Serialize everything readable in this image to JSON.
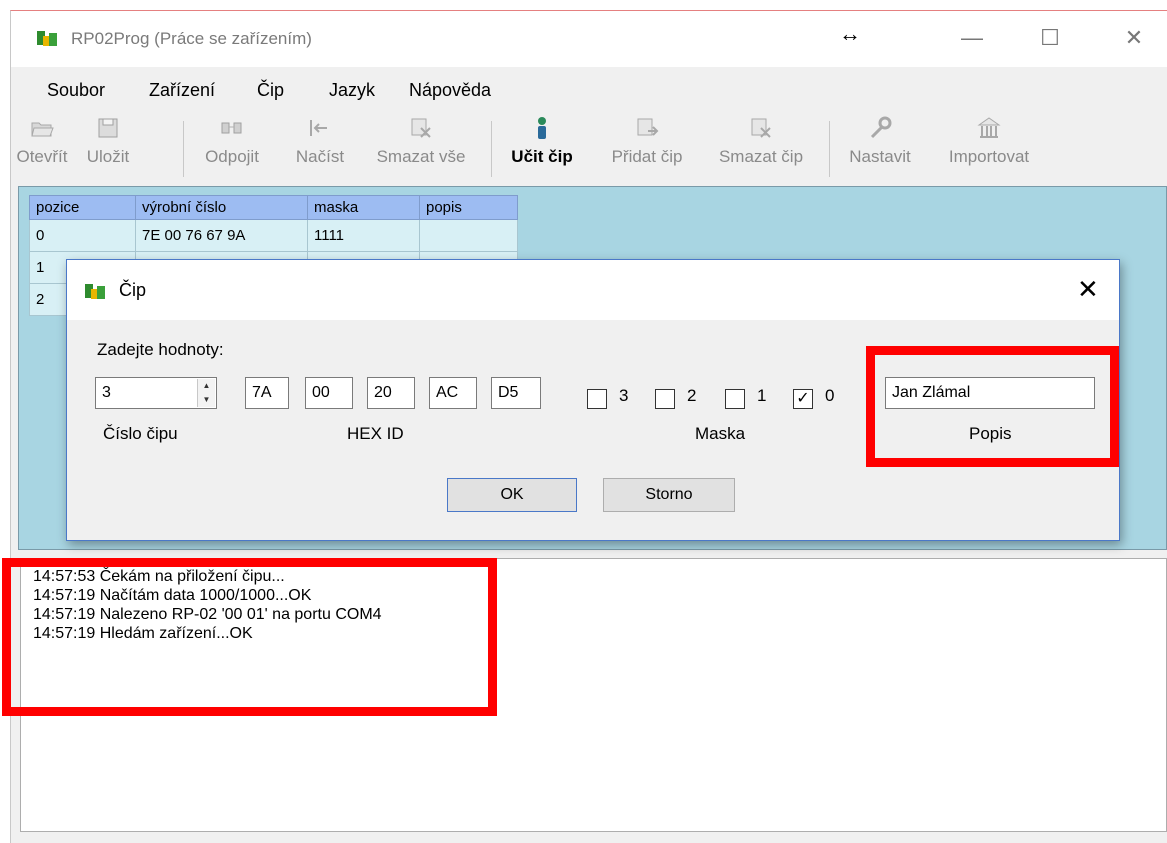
{
  "window": {
    "title": "RP02Prog (Práce se zařízením)",
    "controls": {
      "resize": "↔",
      "minimize": "—",
      "maximize": "☐",
      "close": "✕"
    }
  },
  "menu": [
    "Soubor",
    "Zařízení",
    "Čip",
    "Jazyk",
    "Nápověda"
  ],
  "toolbar": [
    {
      "label": "Otevřít",
      "icon": "folder-open-icon",
      "enabled": false
    },
    {
      "label": "Uložit",
      "icon": "save-disk-icon",
      "enabled": false
    },
    {
      "label": "Odpojit",
      "icon": "disconnect-icon",
      "enabled": false
    },
    {
      "label": "Načíst",
      "icon": "load-arrow-icon",
      "enabled": false
    },
    {
      "label": "Smazat vše",
      "icon": "delete-all-icon",
      "enabled": false
    },
    {
      "label": "Učit čip",
      "icon": "teach-chip-icon",
      "enabled": true
    },
    {
      "label": "Přidat čip",
      "icon": "add-chip-icon",
      "enabled": false
    },
    {
      "label": "Smazat čip",
      "icon": "delete-chip-icon",
      "enabled": false
    },
    {
      "label": "Nastavit",
      "icon": "wrench-icon",
      "enabled": false
    },
    {
      "label": "Importovat",
      "icon": "import-building-icon",
      "enabled": false
    }
  ],
  "table": {
    "headers": [
      "pozice",
      "výrobní číslo",
      "maska",
      "popis"
    ],
    "rows": [
      [
        "0",
        "7E 00 76 67 9A",
        "1111",
        ""
      ],
      [
        "1",
        "",
        "",
        ""
      ],
      [
        "2",
        "",
        "",
        ""
      ]
    ]
  },
  "dialog": {
    "title": "Čip",
    "close": "✕",
    "prompt": "Zadejte hodnoty:",
    "chip_number": {
      "value": "3",
      "caption": "Číslo čipu"
    },
    "hex_id": {
      "bytes": [
        "7A",
        "00",
        "20",
        "AC",
        "D5"
      ],
      "caption": "HEX ID"
    },
    "mask": {
      "caption": "Maska",
      "bits": [
        {
          "label": "3",
          "checked": false
        },
        {
          "label": "2",
          "checked": false
        },
        {
          "label": "1",
          "checked": false
        },
        {
          "label": "0",
          "checked": true
        }
      ]
    },
    "description": {
      "value": "Jan Zlámal",
      "caption": "Popis"
    },
    "ok_label": "OK",
    "cancel_label": "Storno"
  },
  "log": [
    "14:57:53  Čekám na přiložení čipu...",
    "14:57:19  Načítám data 1000/1000...OK",
    "14:57:19  Nalezeno RP-02 '00 01' na portu COM4",
    "14:57:19  Hledám zařízení...OK"
  ],
  "colors": {
    "grid_background": "#a8d5e2",
    "table_header": "#9dbcf2",
    "annotation": "#ff0000",
    "dialog_border": "#4a78c8"
  }
}
